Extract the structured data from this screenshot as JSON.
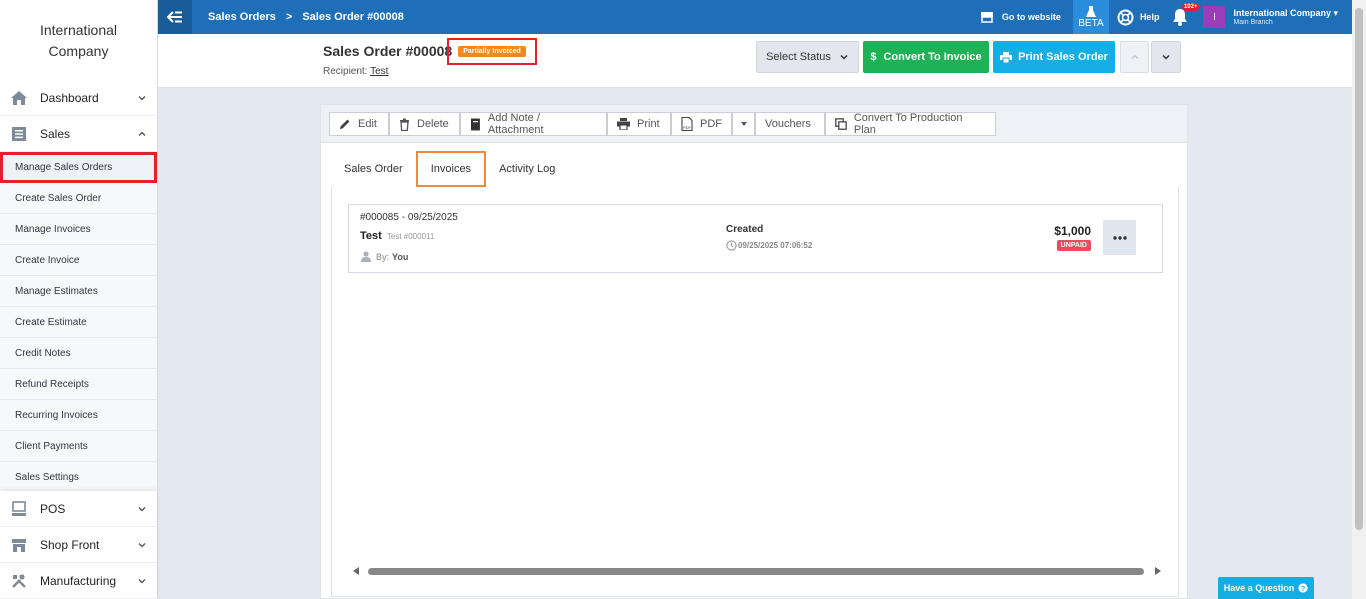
{
  "sidebar": {
    "brand": "International\nCompany",
    "brand_line1": "International",
    "brand_line2": "Company",
    "top_items": [
      {
        "label": "Dashboard",
        "icon": "home-icon"
      },
      {
        "label": "Sales",
        "icon": "sales-icon"
      }
    ],
    "sales_subitems": [
      "Manage Sales Orders",
      "Create Sales Order",
      "Manage Invoices",
      "Create Invoice",
      "Manage Estimates",
      "Create Estimate",
      "Credit Notes",
      "Refund Receipts",
      "Recurring Invoices",
      "Client Payments",
      "Sales Settings"
    ],
    "bottom_items": [
      {
        "label": "POS",
        "icon": "pos-icon"
      },
      {
        "label": "Shop Front",
        "icon": "shop-icon"
      },
      {
        "label": "Manufacturing",
        "icon": "tools-icon"
      }
    ]
  },
  "topbar": {
    "crumb1": "Sales Orders",
    "crumb2": "Sales Order #00008",
    "go_to_website": "Go to website",
    "beta": "BETA",
    "help": "Help",
    "notif_count": "102+",
    "user_initial": "I",
    "user_name": "International Company",
    "user_branch": "Main Branch"
  },
  "header": {
    "title": "Sales Order #00008",
    "status_badge": "Partially Invoiced",
    "recipient_label": "Recipient:",
    "recipient_name": "Test",
    "select_status": "Select Status",
    "convert_invoice": "Convert To Invoice",
    "print_order": "Print Sales Order"
  },
  "toolbar": {
    "edit": "Edit",
    "delete": "Delete",
    "add_note": "Add Note / Attachment",
    "print": "Print",
    "pdf": "PDF",
    "vouchers": "Vouchers",
    "production_plan": "Convert To Production Plan"
  },
  "tabs": [
    "Sales Order",
    "Invoices",
    "Activity Log"
  ],
  "invoice": {
    "number_date": "#000085 - 09/25/2025",
    "client": "Test",
    "client_ref": "Test #000011",
    "by_label": "By:",
    "by_value": "You",
    "status": "Created",
    "status_time": "09/25/2025 07:06:52",
    "amount": "$1,000",
    "payment_status": "UNPAID"
  },
  "footer": {
    "have_question": "Have a Question"
  },
  "colors": {
    "topbar": "#1e6fb8",
    "convert_btn": "#1fb156",
    "print_btn": "#14aee4",
    "partial_badge": "#f08a1c",
    "unpaid_badge": "#e94b5f",
    "highlight_red": "#e3202d",
    "highlight_orange": "#f08a3c"
  }
}
